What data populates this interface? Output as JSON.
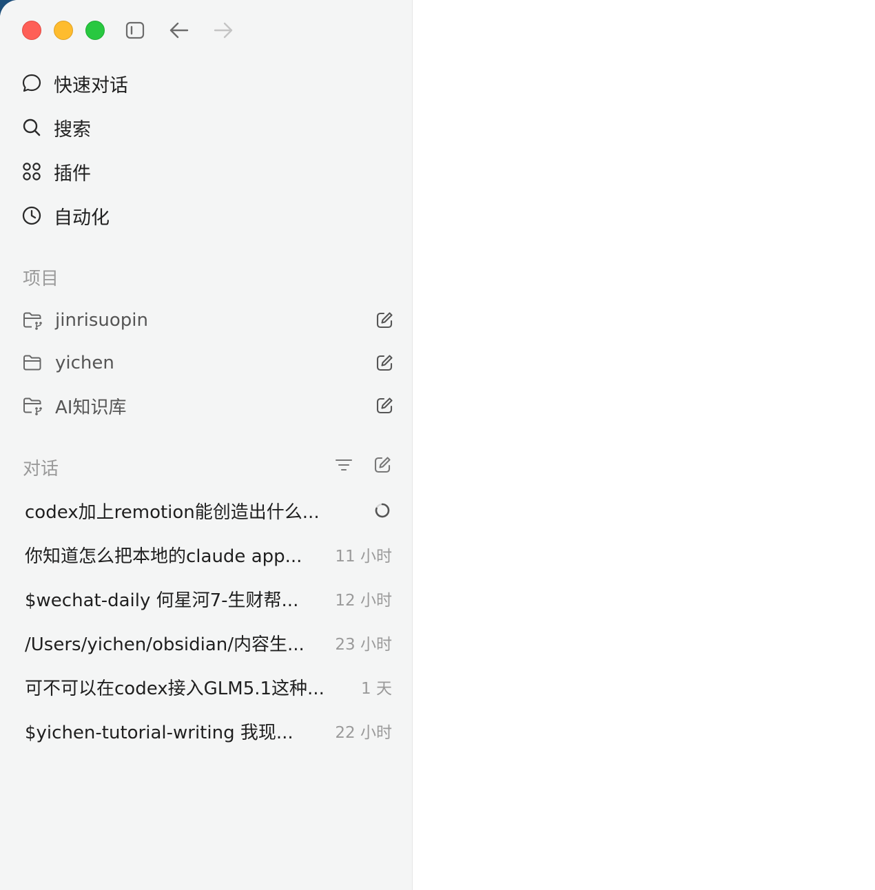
{
  "nav": {
    "quick_chat": "快速对话",
    "search": "搜索",
    "plugins": "插件",
    "automation": "自动化"
  },
  "projects": {
    "title": "项目",
    "items": [
      {
        "label": "jinrisuopin",
        "icon": "folder-branch-icon"
      },
      {
        "label": "yichen",
        "icon": "folder-icon"
      },
      {
        "label": "AI知识库",
        "icon": "folder-branch-icon"
      }
    ]
  },
  "conversations": {
    "title": "对话",
    "items": [
      {
        "title": "codex加上remotion能创造出什么...",
        "time": ""
      },
      {
        "title": "你知道怎么把本地的claude app...",
        "time": "11 小时"
      },
      {
        "title": "$wechat-daily 何星河7-生财帮...",
        "time": "12 小时"
      },
      {
        "title": "/Users/yichen/obsidian/内容生...",
        "time": "23 小时"
      },
      {
        "title": "可不可以在codex接入GLM5.1这种...",
        "time": "1 天"
      },
      {
        "title": "$yichen-tutorial-writing 我现...",
        "time": "22 小时"
      }
    ]
  },
  "colors": {
    "close": "#fe5f57",
    "minimize": "#febc2e",
    "maximize": "#28c840",
    "sidebar_bg": "#f4f5f5"
  }
}
